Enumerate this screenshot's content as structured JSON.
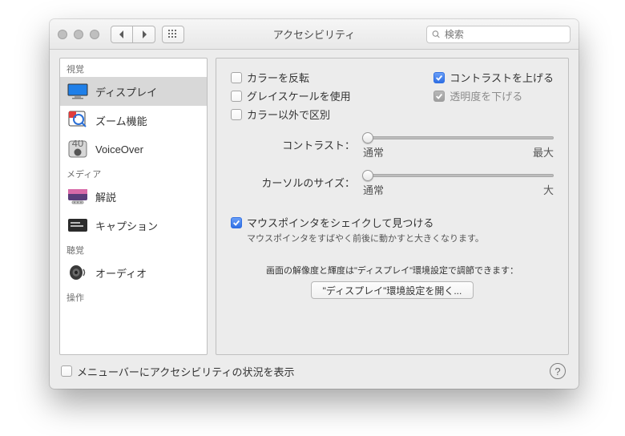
{
  "title": "アクセシビリティ",
  "search": {
    "placeholder": "検索"
  },
  "sidebar": {
    "groups": [
      {
        "label": "視覚",
        "items": [
          {
            "label": "ディスプレイ",
            "icon": "display",
            "selected": true
          },
          {
            "label": "ズーム機能",
            "icon": "zoom"
          },
          {
            "label": "VoiceOver",
            "icon": "voiceover"
          }
        ]
      },
      {
        "label": "メディア",
        "items": [
          {
            "label": "解説",
            "icon": "descriptions"
          },
          {
            "label": "キャプション",
            "icon": "captions"
          }
        ]
      },
      {
        "label": "聴覚",
        "items": [
          {
            "label": "オーディオ",
            "icon": "audio"
          }
        ]
      },
      {
        "label": "操作",
        "items": []
      }
    ]
  },
  "options": {
    "invert": "カラーを反転",
    "grayscale": "グレイスケールを使用",
    "diffcolor": "カラー以外で区別",
    "increase_contrast": "コントラストを上げる",
    "reduce_transparency": "透明度を下げる",
    "contrast_label": "コントラスト：",
    "cursor_label": "カーソルのサイズ：",
    "tick_normal": "通常",
    "tick_max": "最大",
    "tick_large": "大",
    "shake": "マウスポインタをシェイクして見つける",
    "shake_sub": "マウスポインタをすばやく前後に動かすと大きくなります。",
    "info": "画面の解像度と輝度は\"ディスプレイ\"環境設定で調節できます：",
    "open_btn": "\"ディスプレイ\"環境設定を開く..."
  },
  "footer": {
    "menubar": "メニューバーにアクセシビリティの状況を表示"
  }
}
